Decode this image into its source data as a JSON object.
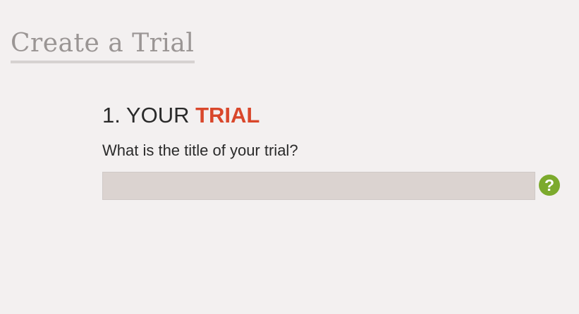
{
  "page": {
    "title": "Create a Trial"
  },
  "section": {
    "number_prefix": "1. YOUR ",
    "accent_word": "TRIAL",
    "question": "What is the title of your trial?"
  },
  "trial_title_field": {
    "value": "",
    "placeholder": ""
  },
  "help": {
    "icon": "question-circle-icon",
    "glyph": "?"
  },
  "colors": {
    "background": "#f3f0f0",
    "title_text": "#9a9594",
    "accent": "#d9472b",
    "help_icon": "#7caa2d",
    "input_background": "#dbd3d0"
  }
}
